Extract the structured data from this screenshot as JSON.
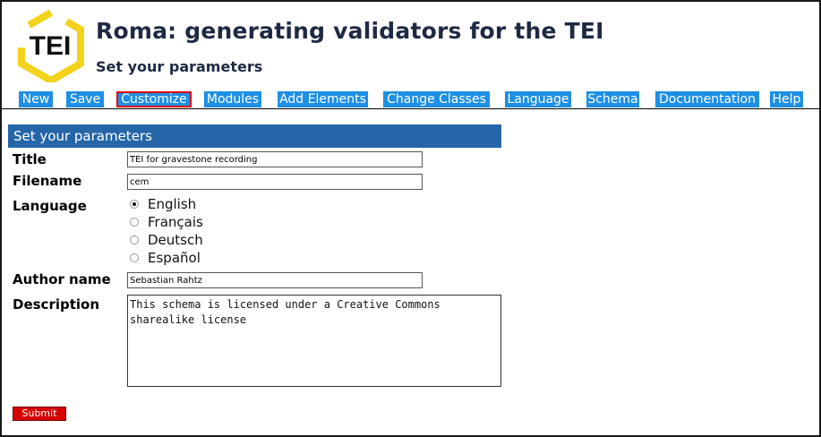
{
  "header": {
    "logo_text": "TEI",
    "title": "Roma: generating validators for the TEI",
    "subtitle": "Set your parameters"
  },
  "nav": {
    "items": [
      {
        "label": "New"
      },
      {
        "label": "Save"
      },
      {
        "label": "Customize",
        "active": true
      },
      {
        "label": "Modules"
      },
      {
        "label": "Add Elements"
      },
      {
        "label": "Change Classes"
      },
      {
        "label": "Language"
      },
      {
        "label": "Schema"
      },
      {
        "label": "Documentation"
      },
      {
        "label": "Help"
      }
    ]
  },
  "form": {
    "section_title": "Set your parameters",
    "title": {
      "label": "Title",
      "value": "TEI for gravestone recording"
    },
    "filename": {
      "label": "Filename",
      "value": "cem"
    },
    "language": {
      "label": "Language",
      "options": [
        {
          "label": "English",
          "checked": true
        },
        {
          "label": "Français",
          "checked": false
        },
        {
          "label": "Deutsch",
          "checked": false
        },
        {
          "label": "Español",
          "checked": false
        }
      ]
    },
    "author": {
      "label": "Author name",
      "value": "Sebastian Rahtz"
    },
    "description": {
      "label": "Description",
      "value": "This schema is licensed under a Creative Commons\nsharealike license"
    },
    "submit_label": "Submit"
  },
  "colors": {
    "nav_bg": "#1d8fe5",
    "active_outline": "#e00000",
    "section_header_bg": "#2566a8",
    "submit_bg": "#d40000",
    "title_text": "#1e2a44",
    "logo_accent": "#f2d21b"
  }
}
